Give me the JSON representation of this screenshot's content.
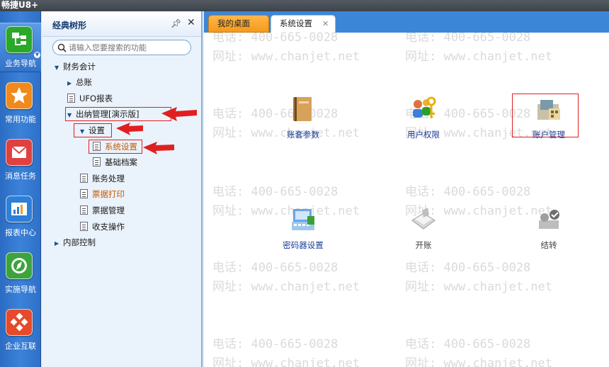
{
  "app": {
    "title_fragment": "畅捷U8+"
  },
  "rail": {
    "items": [
      {
        "label": "业务导航",
        "icon": "business-nav-icon",
        "color": "#2aa82a"
      },
      {
        "label": "常用功能",
        "icon": "star-icon",
        "color": "#f08a1a"
      },
      {
        "label": "消息任务",
        "icon": "message-icon",
        "color": "#e04040"
      },
      {
        "label": "报表中心",
        "icon": "report-icon",
        "color": "#2e7fd8"
      },
      {
        "label": "实施导航",
        "icon": "compass-icon",
        "color": "#3da33d"
      },
      {
        "label": "企业互联",
        "icon": "enterprise-icon",
        "color": "#e54a2a"
      }
    ]
  },
  "tree_panel": {
    "title": "经典树形",
    "search_placeholder": "请输入您要搜索的功能",
    "nodes": [
      {
        "label": "财务会计"
      },
      {
        "label": "总账"
      },
      {
        "label": "UFO报表"
      },
      {
        "label": "出纳管理[演示版]"
      },
      {
        "label": "设置"
      },
      {
        "label": "系统设置"
      },
      {
        "label": "基础档案"
      },
      {
        "label": "账务处理"
      },
      {
        "label": "票据打印"
      },
      {
        "label": "票据管理"
      },
      {
        "label": "收支操作"
      },
      {
        "label": "内部控制"
      }
    ]
  },
  "tabs": [
    {
      "label": "我的桌面"
    },
    {
      "label": "系统设置"
    }
  ],
  "functions": [
    {
      "label": "账套参数",
      "icon": "book-icon"
    },
    {
      "label": "用户权限",
      "icon": "user-key-icon"
    },
    {
      "label": "账户管理",
      "icon": "account-icon"
    },
    {
      "label": "密码器设置",
      "icon": "password-device-icon"
    },
    {
      "label": "开账",
      "icon": "open-book-icon"
    },
    {
      "label": "结转",
      "icon": "carry-over-icon"
    }
  ],
  "watermark": {
    "phone": "电话: 400-665-0028",
    "site": "网址: www.chanjet.net"
  },
  "colors": {
    "highlight_red": "#e02020",
    "tab_active_orange": "#f59a1b",
    "nav_blue": "#2c6cc3"
  }
}
